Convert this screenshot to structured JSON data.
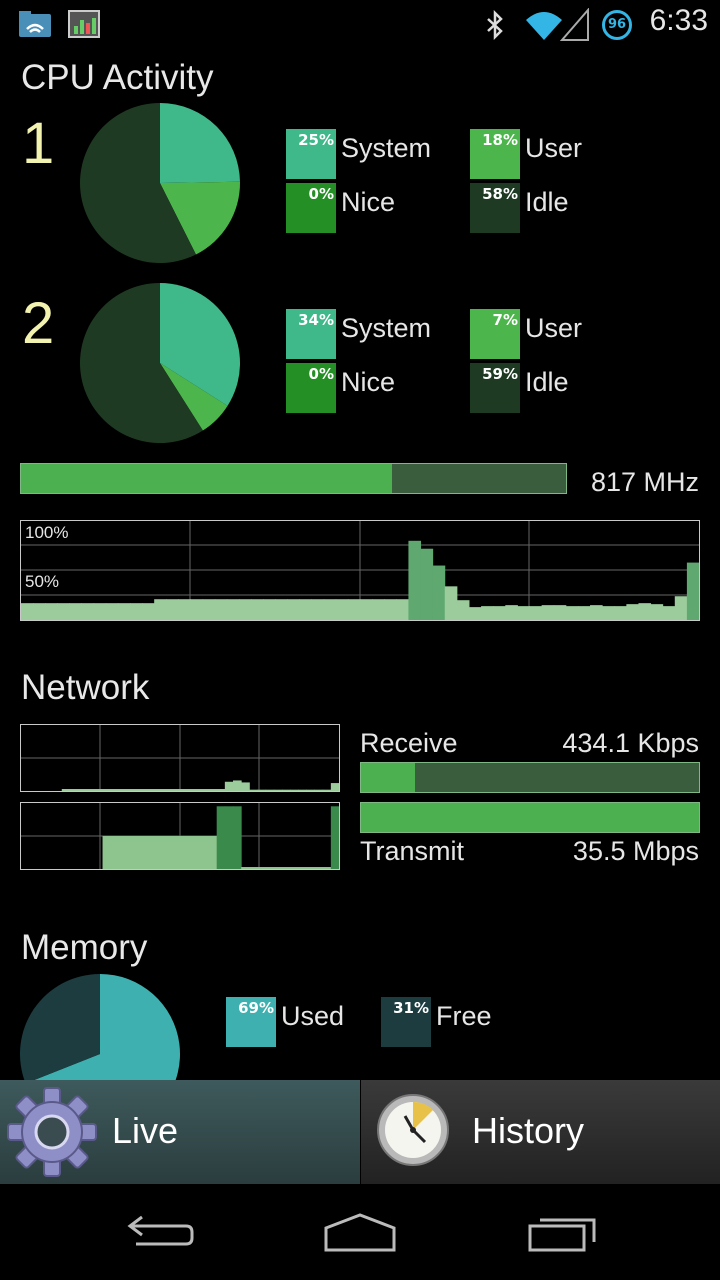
{
  "status_bar": {
    "time": "6:33",
    "badge": "96",
    "icons": [
      "wifi-manager-icon",
      "cpu-monitor-icon",
      "bluetooth-icon",
      "wifi-signal-icon",
      "cell-signal-icon"
    ]
  },
  "cpu": {
    "title": "CPU Activity",
    "cores": [
      {
        "number": "1",
        "system": {
          "label": "System",
          "pct": "25%",
          "value": 25
        },
        "user": {
          "label": "User",
          "pct": "18%",
          "value": 18
        },
        "nice": {
          "label": "Nice",
          "pct": "0%",
          "value": 0
        },
        "idle": {
          "label": "Idle",
          "pct": "58%",
          "value": 58
        }
      },
      {
        "number": "2",
        "system": {
          "label": "System",
          "pct": "34%",
          "value": 34
        },
        "user": {
          "label": "User",
          "pct": "7%",
          "value": 7
        },
        "nice": {
          "label": "Nice",
          "pct": "0%",
          "value": 0
        },
        "idle": {
          "label": "Idle",
          "pct": "59%",
          "value": 59
        }
      }
    ],
    "frequency": "817 MHz",
    "frequency_fraction": 0.68,
    "graph_labels": {
      "top": "100%",
      "mid": "50%"
    },
    "history": [
      17,
      17,
      17,
      17,
      17,
      17,
      17,
      17,
      17,
      17,
      17,
      21,
      21,
      21,
      21,
      21,
      21,
      21,
      21,
      21,
      21,
      21,
      21,
      21,
      21,
      21,
      21,
      21,
      21,
      21,
      21,
      21,
      80,
      72,
      55,
      34,
      20,
      13,
      14,
      14,
      15,
      14,
      14,
      15,
      15,
      14,
      14,
      15,
      14,
      14,
      16,
      17,
      16,
      14,
      24,
      58
    ]
  },
  "network": {
    "title": "Network",
    "receive_label": "Receive",
    "receive_value": "434.1 Kbps",
    "receive_fraction": 0.16,
    "transmit_label": "Transmit",
    "transmit_value": "35.5 Mbps",
    "transmit_fraction": 1.0,
    "receive_history": [
      0,
      0,
      0,
      0,
      0,
      3,
      3,
      3,
      3,
      3,
      3,
      3,
      3,
      3,
      3,
      3,
      3,
      3,
      3,
      3,
      3,
      3,
      3,
      3,
      3,
      14,
      16,
      13,
      2,
      2,
      2,
      2,
      2,
      2,
      2,
      2,
      2,
      2,
      12
    ],
    "transmit_history": [
      0,
      0,
      0,
      0,
      0,
      0,
      0,
      0,
      0,
      0,
      50,
      50,
      50,
      50,
      50,
      50,
      50,
      50,
      50,
      50,
      50,
      50,
      50,
      50,
      95,
      95,
      95,
      3,
      3,
      3,
      3,
      3,
      3,
      3,
      3,
      3,
      3,
      3,
      95
    ]
  },
  "memory": {
    "title": "Memory",
    "used": {
      "label": "Used",
      "pct": "69%",
      "value": 69
    },
    "free": {
      "label": "Free",
      "pct": "31%",
      "value": 31
    }
  },
  "tabs": [
    {
      "label": "Live",
      "selected": true
    },
    {
      "label": "History",
      "selected": false
    }
  ],
  "colors": {
    "system": "#3fb88a",
    "user": "#4cb64c",
    "nice": "#248f24",
    "idle": "#1f3a22",
    "mem_used": "#3fb0b0",
    "mem_free": "#1c3c40",
    "accent": "#33b5e5"
  }
}
